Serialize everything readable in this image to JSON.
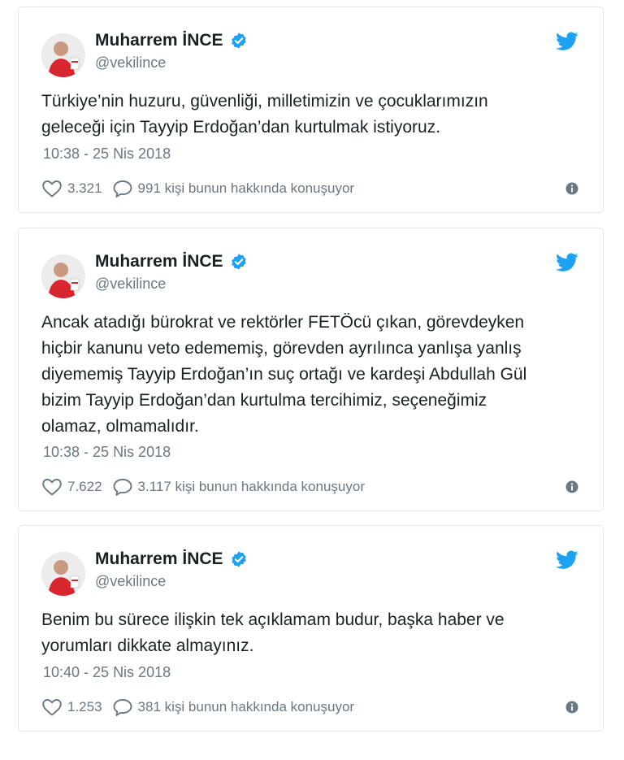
{
  "tweets": [
    {
      "author": {
        "name": "Muharrem İNCE",
        "handle": "@vekilince",
        "verified": true
      },
      "text": "Türkiye’nin huzuru, güvenliği, milletimizin ve çocuklarımızın\ngeleceği için Tayyip Erdoğan’dan kurtulmak istiyoruz.",
      "timestamp": "10:38 - 25 Nis 2018",
      "likes": "3.321",
      "replies": "991 kişi bunun hakkında konuşuyor"
    },
    {
      "author": {
        "name": "Muharrem İNCE",
        "handle": "@vekilince",
        "verified": true
      },
      "text": "Ancak atadığı bürokrat ve rektörler FETÖcü çıkan, görevdeyken\nhiçbir kanunu veto edememiş, görevden ayrılınca yanlışa yanlış\ndiyememiş Tayyip Erdoğan’ın suç ortağı ve kardeşi Abdullah Gül\nbizim Tayyip Erdoğan’dan kurtulma tercihimiz, seçeneğimiz\nolamaz, olmamalıdır.",
      "timestamp": "10:38 - 25 Nis 2018",
      "likes": "7.622",
      "replies": "3.117 kişi bunun hakkında konuşuyor"
    },
    {
      "author": {
        "name": "Muharrem İNCE",
        "handle": "@vekilince",
        "verified": true
      },
      "text": "Benim bu sürece ilişkin tek açıklamam budur, başka haber ve\nyorumları dikkate almayınız.",
      "timestamp": "10:40 - 25 Nis 2018",
      "likes": "1.253",
      "replies": "381 kişi bunun hakkında konuşuyor"
    }
  ],
  "icons": {
    "verified": "verified-badge-icon",
    "twitter": "twitter-bird-icon",
    "like": "heart-icon",
    "reply": "speech-bubble-icon",
    "info": "info-icon"
  },
  "colors": {
    "twitter_blue": "#1da1f2",
    "text": "#1c2022",
    "muted": "#697882",
    "border": "#e1e8ed"
  }
}
